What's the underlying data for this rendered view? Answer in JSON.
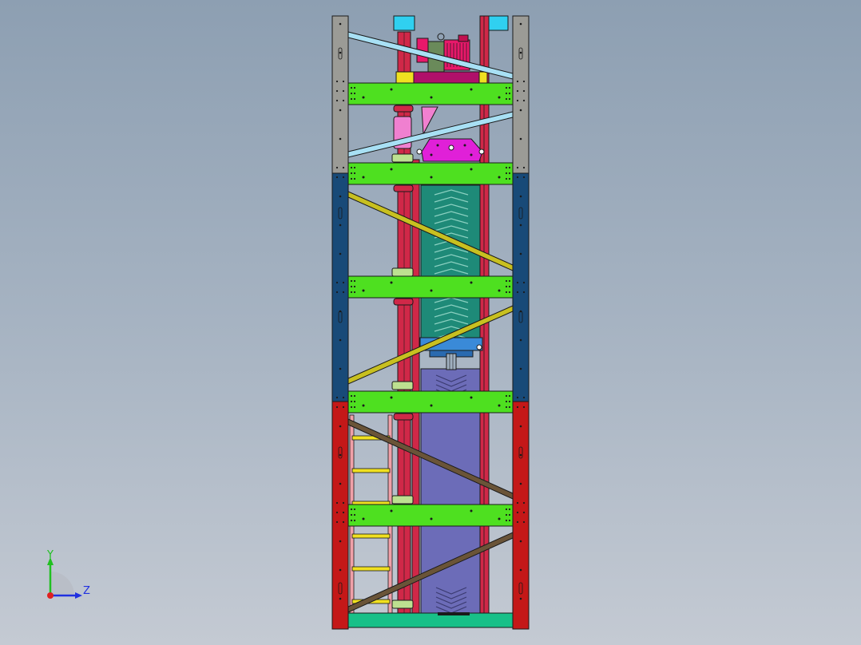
{
  "viewport": {
    "background_top": "#8d9fb2",
    "background_bottom": "#c4cad3"
  },
  "model": {
    "outline_color": "#1a1a1a",
    "colors": {
      "column_top": "#9b9b96",
      "column_middle": "#184a78",
      "column_bottom": "#c41818",
      "crossbeam": "#4ee020",
      "brace_top": "#a8e0f4",
      "brace_middle": "#c8c020",
      "brace_bottom": "#6a5438",
      "guide_rail": "#d02848",
      "motor": "#e8186a",
      "gearbox": "#e020d8",
      "conveyor_belt": "#1e8a78",
      "bucket_chamber": "#6c6cb8",
      "carriage": "#3a8ad8",
      "ladder_rails": "#f0a0a8",
      "ladder_rungs": "#f0e020",
      "base_plate": "#18c088",
      "bracket": "#bde090",
      "top_block": "#30d0f0",
      "cone": "#f080d0"
    }
  },
  "triad": {
    "y_label": "Y",
    "z_label": "Z",
    "y_color": "#20c020",
    "z_color": "#2030e0",
    "x_color": "#e02020"
  }
}
